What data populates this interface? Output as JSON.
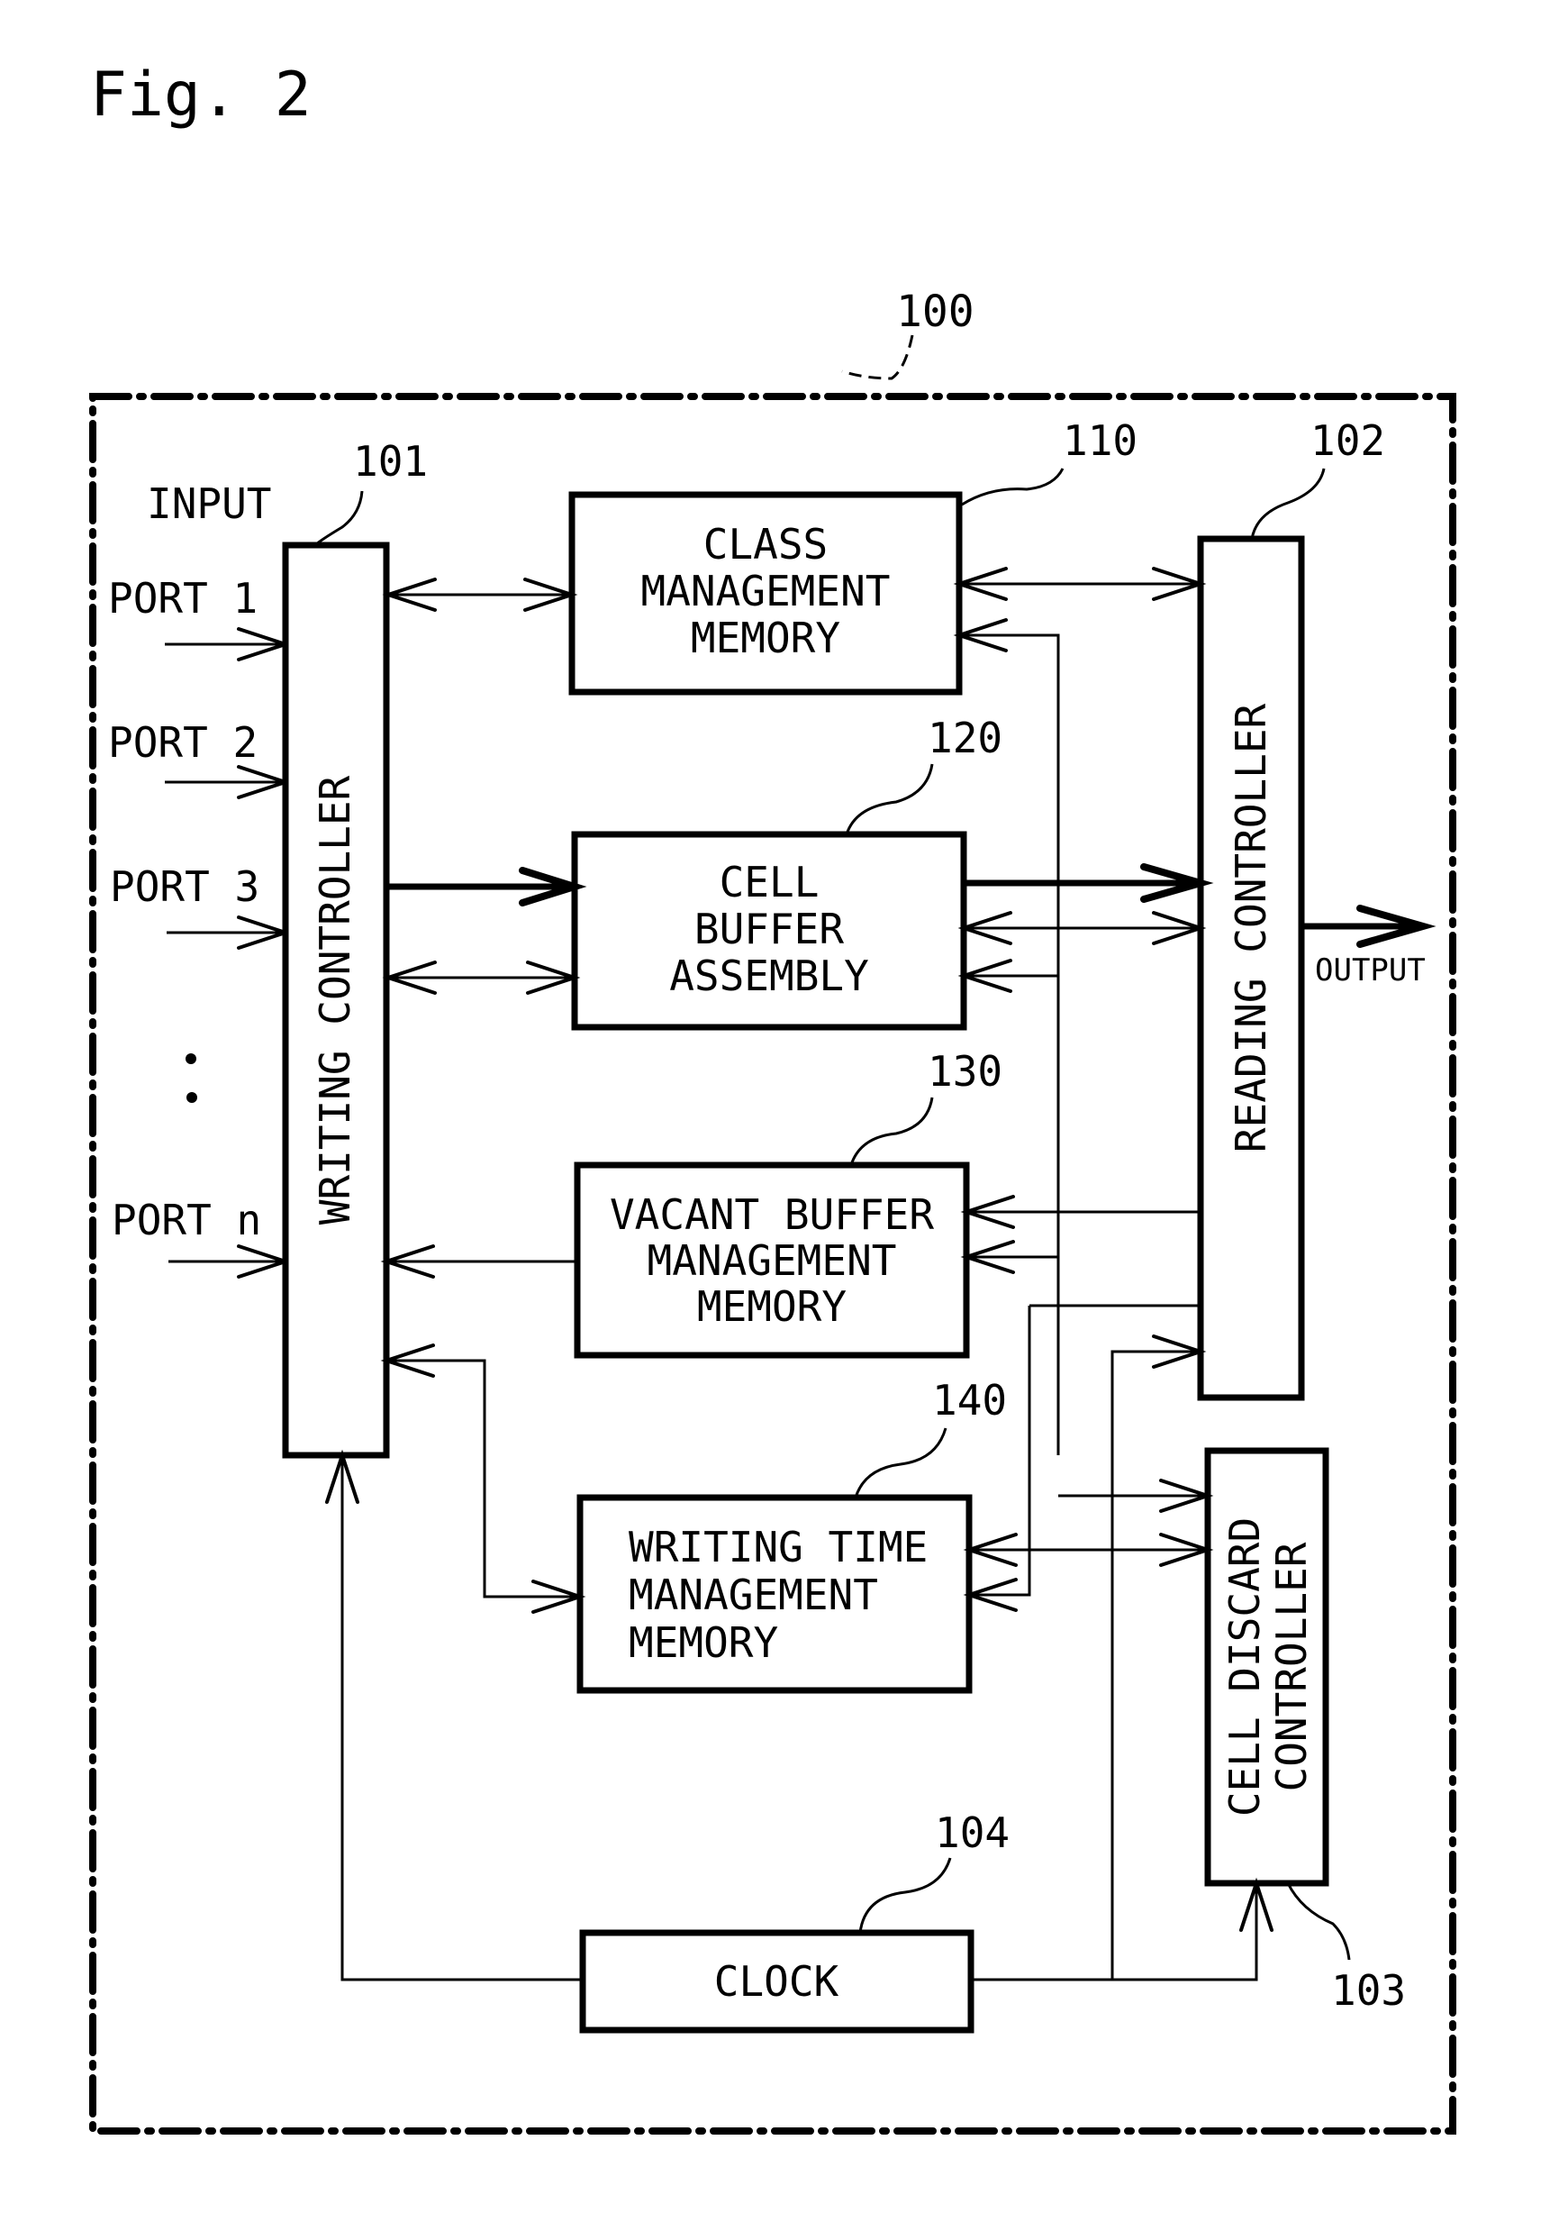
{
  "figure_label": "Fig. 2",
  "system": {
    "ref": "100"
  },
  "input": {
    "heading": "INPUT",
    "ports": [
      "PORT 1",
      "PORT 2",
      "PORT 3",
      "PORT n"
    ],
    "ellipsis": ":"
  },
  "output": {
    "label": "OUTPUT"
  },
  "blocks": {
    "writing_controller": {
      "ref": "101",
      "label": "WRITING CONTROLLER"
    },
    "reading_controller": {
      "ref": "102",
      "label": "READING CONTROLLER"
    },
    "cell_discard_controller": {
      "ref": "103",
      "lines": [
        "CELL DISCARD",
        "CONTROLLER"
      ]
    },
    "clock": {
      "ref": "104",
      "label": "CLOCK"
    },
    "class_management_memory": {
      "ref": "110",
      "lines": [
        "CLASS",
        "MANAGEMENT",
        "MEMORY"
      ]
    },
    "cell_buffer_assembly": {
      "ref": "120",
      "lines": [
        "CELL",
        "BUFFER",
        "ASSEMBLY"
      ]
    },
    "vacant_buffer_management_memory": {
      "ref": "130",
      "lines": [
        "VACANT BUFFER",
        "MANAGEMENT",
        "MEMORY"
      ]
    },
    "writing_time_management_memory": {
      "ref": "140",
      "lines": [
        "WRITING TIME",
        "MANAGEMENT",
        "MEMORY"
      ]
    }
  }
}
